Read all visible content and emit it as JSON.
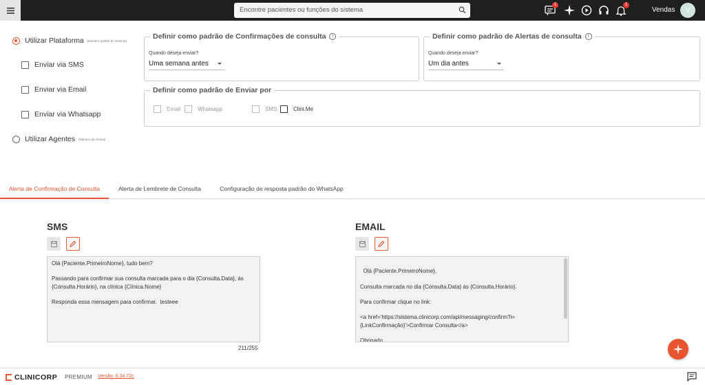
{
  "header": {
    "search_placeholder": "Encontre pacientes ou funções do sistema",
    "badge_count_1": "1",
    "badge_count_2": "1",
    "user_name": "Vendas",
    "avatar_letter": "V"
  },
  "options": {
    "plataforma_label": "Utilizar Plataforma",
    "plataforma_note": "(Número padrão do sistema)",
    "sms_label": "Enviar via SMS",
    "email_label": "Enviar via Email",
    "whatsapp_label": "Enviar via Whatsapp",
    "agentes_label": "Utilizar Agentes",
    "agentes_note": "(Número da clínica)"
  },
  "confirmacoes": {
    "title": "Definir como padrão de Confirmações de consulta",
    "field_label": "Quando deseja enviar?",
    "field_value": "Uma semana antes"
  },
  "alertas": {
    "title": "Definir como padrão de Alertas de consulta",
    "field_label": "Quando deseja enviar?",
    "field_value": "Um dia antes"
  },
  "enviar_por": {
    "title": "Definir como padrão de Enviar por",
    "options": [
      "Email",
      "Whatsapp",
      "SMS",
      "Clini.Me"
    ]
  },
  "tabs": [
    "Alerta de Confirmação de Consulta",
    "Alerta de Lembrete de Consulta",
    "Configuração de resposta padrão do WhatsApp"
  ],
  "sms": {
    "title": "SMS",
    "text": "Olá {Paciente.PrimeiroNome}, tudo bem?\n\nPassando para confirmar sua consulta marcada para o dia {Consulta.Data}, às {Consulta.Horário}, na clínica {Clínica.Nome}\n\nResponda essa mensagem para confirmar.  testeee",
    "counter": "211/255"
  },
  "email": {
    "title": "EMAIL",
    "text": "Olá {Paciente.PrimeiroNome},\n\nConsulta marcada no dia {Consulta.Data} às {Consulta.Horário}.\n\nPara confirmar clique no link:\n\n<a href='https://sistema.clinicorp.com/api/messaging/confirm?i={LinkConfirmação}'>Confirmar Consulta</a>\n\nObrigado,"
  },
  "footer": {
    "brand": "CLINICORP",
    "plan": "PREMIUM",
    "version": "Versão: 0.34.72c"
  },
  "colors": {
    "accent": "#e8542f",
    "topbar": "#1f1f1f"
  }
}
